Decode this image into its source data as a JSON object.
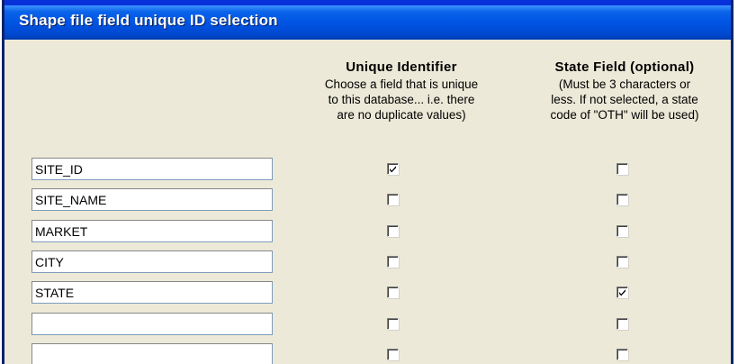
{
  "window": {
    "title": "Shape file field unique ID selection"
  },
  "columns": {
    "unique": {
      "heading": "Unique Identifier",
      "desc_lines": [
        "Choose a field that is unique",
        "to this database... i.e. there",
        "are no duplicate values)"
      ]
    },
    "state": {
      "heading": "State Field (optional)",
      "desc_lines": [
        "(Must be 3 characters or",
        "less.  If not selected, a state",
        "code of \"OTH\" will be used)"
      ]
    }
  },
  "rows": [
    {
      "field": "SITE_ID",
      "unique": true,
      "state": false
    },
    {
      "field": "SITE_NAME",
      "unique": false,
      "state": false
    },
    {
      "field": "MARKET",
      "unique": false,
      "state": false
    },
    {
      "field": "CITY",
      "unique": false,
      "state": false
    },
    {
      "field": "STATE",
      "unique": false,
      "state": true
    },
    {
      "field": "",
      "unique": false,
      "state": false
    },
    {
      "field": "",
      "unique": false,
      "state": false
    }
  ],
  "colors": {
    "titlebar": "#0054e3",
    "dialog_bg": "#ece9d8",
    "check": "#21a121"
  }
}
